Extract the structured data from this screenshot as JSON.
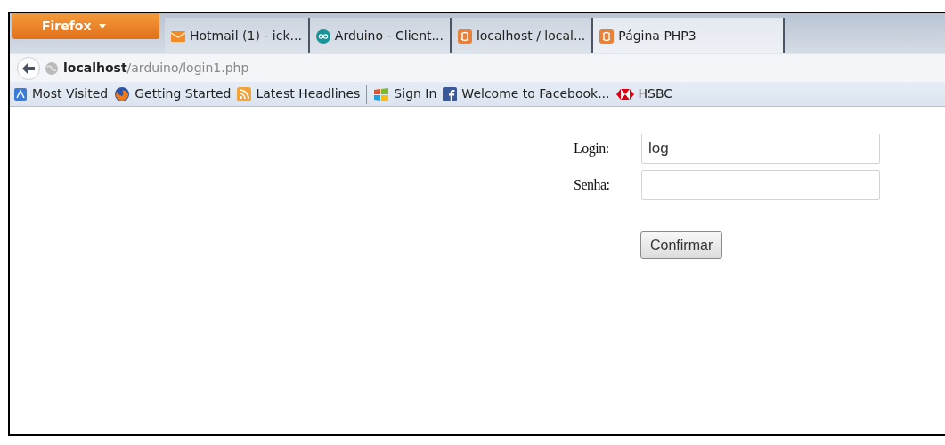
{
  "menu_button": {
    "label": "Firefox"
  },
  "tabs": [
    {
      "kind": "mail",
      "label": "Hotmail (1) - ick...",
      "selected": false
    },
    {
      "kind": "arduino",
      "label": "Arduino - Client...",
      "selected": false
    },
    {
      "kind": "xampp",
      "label": "localhost / local...",
      "selected": false
    },
    {
      "kind": "xampp",
      "label": "Página PHP3",
      "selected": true
    }
  ],
  "address": {
    "host": "localhost",
    "path": "/arduino/login1.php"
  },
  "bookmarks": [
    {
      "kind": "visited",
      "label": "Most Visited"
    },
    {
      "kind": "firefox",
      "label": "Getting Started"
    },
    {
      "kind": "rss",
      "label": "Latest Headlines"
    },
    {
      "kind": "separator"
    },
    {
      "kind": "windows",
      "label": "Sign In"
    },
    {
      "kind": "facebook",
      "label": "Welcome to Facebook..."
    },
    {
      "kind": "hsbc",
      "label": "HSBC"
    }
  ],
  "form": {
    "fields": [
      {
        "label": "Login:",
        "value": "log"
      },
      {
        "label": "Senha:"
      }
    ],
    "button": "Confirmar"
  }
}
